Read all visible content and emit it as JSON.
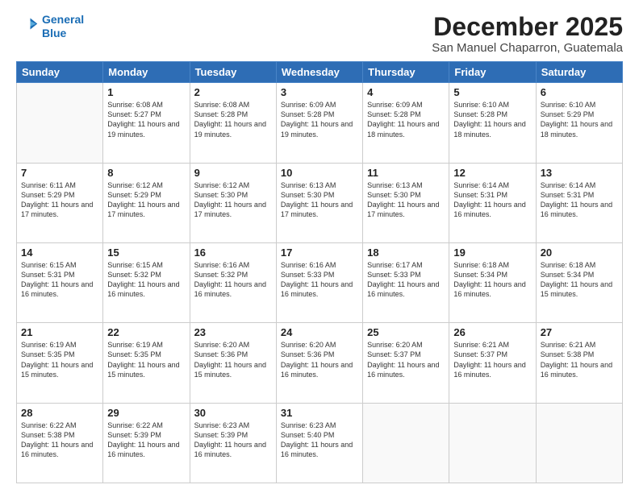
{
  "header": {
    "logo_line1": "General",
    "logo_line2": "Blue",
    "month": "December 2025",
    "location": "San Manuel Chaparron, Guatemala"
  },
  "weekdays": [
    "Sunday",
    "Monday",
    "Tuesday",
    "Wednesday",
    "Thursday",
    "Friday",
    "Saturday"
  ],
  "weeks": [
    [
      {
        "day": "",
        "info": ""
      },
      {
        "day": "1",
        "info": "Sunrise: 6:08 AM\nSunset: 5:27 PM\nDaylight: 11 hours\nand 19 minutes."
      },
      {
        "day": "2",
        "info": "Sunrise: 6:08 AM\nSunset: 5:28 PM\nDaylight: 11 hours\nand 19 minutes."
      },
      {
        "day": "3",
        "info": "Sunrise: 6:09 AM\nSunset: 5:28 PM\nDaylight: 11 hours\nand 19 minutes."
      },
      {
        "day": "4",
        "info": "Sunrise: 6:09 AM\nSunset: 5:28 PM\nDaylight: 11 hours\nand 18 minutes."
      },
      {
        "day": "5",
        "info": "Sunrise: 6:10 AM\nSunset: 5:28 PM\nDaylight: 11 hours\nand 18 minutes."
      },
      {
        "day": "6",
        "info": "Sunrise: 6:10 AM\nSunset: 5:29 PM\nDaylight: 11 hours\nand 18 minutes."
      }
    ],
    [
      {
        "day": "7",
        "info": "Sunrise: 6:11 AM\nSunset: 5:29 PM\nDaylight: 11 hours\nand 17 minutes."
      },
      {
        "day": "8",
        "info": "Sunrise: 6:12 AM\nSunset: 5:29 PM\nDaylight: 11 hours\nand 17 minutes."
      },
      {
        "day": "9",
        "info": "Sunrise: 6:12 AM\nSunset: 5:30 PM\nDaylight: 11 hours\nand 17 minutes."
      },
      {
        "day": "10",
        "info": "Sunrise: 6:13 AM\nSunset: 5:30 PM\nDaylight: 11 hours\nand 17 minutes."
      },
      {
        "day": "11",
        "info": "Sunrise: 6:13 AM\nSunset: 5:30 PM\nDaylight: 11 hours\nand 17 minutes."
      },
      {
        "day": "12",
        "info": "Sunrise: 6:14 AM\nSunset: 5:31 PM\nDaylight: 11 hours\nand 16 minutes."
      },
      {
        "day": "13",
        "info": "Sunrise: 6:14 AM\nSunset: 5:31 PM\nDaylight: 11 hours\nand 16 minutes."
      }
    ],
    [
      {
        "day": "14",
        "info": "Sunrise: 6:15 AM\nSunset: 5:31 PM\nDaylight: 11 hours\nand 16 minutes."
      },
      {
        "day": "15",
        "info": "Sunrise: 6:15 AM\nSunset: 5:32 PM\nDaylight: 11 hours\nand 16 minutes."
      },
      {
        "day": "16",
        "info": "Sunrise: 6:16 AM\nSunset: 5:32 PM\nDaylight: 11 hours\nand 16 minutes."
      },
      {
        "day": "17",
        "info": "Sunrise: 6:16 AM\nSunset: 5:33 PM\nDaylight: 11 hours\nand 16 minutes."
      },
      {
        "day": "18",
        "info": "Sunrise: 6:17 AM\nSunset: 5:33 PM\nDaylight: 11 hours\nand 16 minutes."
      },
      {
        "day": "19",
        "info": "Sunrise: 6:18 AM\nSunset: 5:34 PM\nDaylight: 11 hours\nand 16 minutes."
      },
      {
        "day": "20",
        "info": "Sunrise: 6:18 AM\nSunset: 5:34 PM\nDaylight: 11 hours\nand 15 minutes."
      }
    ],
    [
      {
        "day": "21",
        "info": "Sunrise: 6:19 AM\nSunset: 5:35 PM\nDaylight: 11 hours\nand 15 minutes."
      },
      {
        "day": "22",
        "info": "Sunrise: 6:19 AM\nSunset: 5:35 PM\nDaylight: 11 hours\nand 15 minutes."
      },
      {
        "day": "23",
        "info": "Sunrise: 6:20 AM\nSunset: 5:36 PM\nDaylight: 11 hours\nand 15 minutes."
      },
      {
        "day": "24",
        "info": "Sunrise: 6:20 AM\nSunset: 5:36 PM\nDaylight: 11 hours\nand 16 minutes."
      },
      {
        "day": "25",
        "info": "Sunrise: 6:20 AM\nSunset: 5:37 PM\nDaylight: 11 hours\nand 16 minutes."
      },
      {
        "day": "26",
        "info": "Sunrise: 6:21 AM\nSunset: 5:37 PM\nDaylight: 11 hours\nand 16 minutes."
      },
      {
        "day": "27",
        "info": "Sunrise: 6:21 AM\nSunset: 5:38 PM\nDaylight: 11 hours\nand 16 minutes."
      }
    ],
    [
      {
        "day": "28",
        "info": "Sunrise: 6:22 AM\nSunset: 5:38 PM\nDaylight: 11 hours\nand 16 minutes."
      },
      {
        "day": "29",
        "info": "Sunrise: 6:22 AM\nSunset: 5:39 PM\nDaylight: 11 hours\nand 16 minutes."
      },
      {
        "day": "30",
        "info": "Sunrise: 6:23 AM\nSunset: 5:39 PM\nDaylight: 11 hours\nand 16 minutes."
      },
      {
        "day": "31",
        "info": "Sunrise: 6:23 AM\nSunset: 5:40 PM\nDaylight: 11 hours\nand 16 minutes."
      },
      {
        "day": "",
        "info": ""
      },
      {
        "day": "",
        "info": ""
      },
      {
        "day": "",
        "info": ""
      }
    ]
  ]
}
